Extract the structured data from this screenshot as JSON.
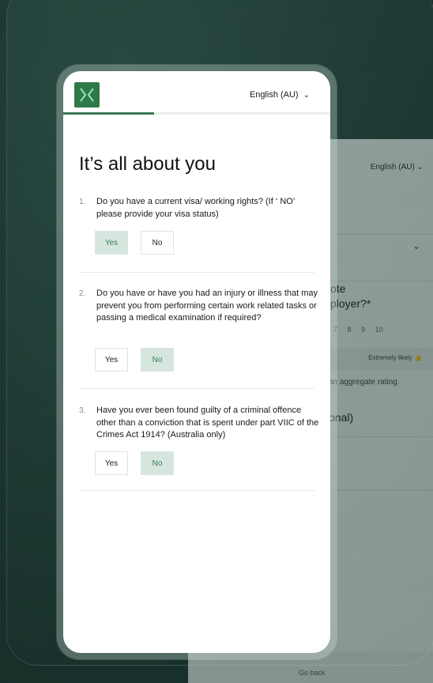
{
  "language_selector": "English (AU)",
  "progress_fraction": 0.34,
  "title": "It’s all about you",
  "questions": [
    {
      "num": "1.",
      "text": "Do you have a current visa/ working rights? (If ‘ NO’ please provide your visa status)",
      "yes": "Yes",
      "no": "No",
      "selected": "yes"
    },
    {
      "num": "2.",
      "text": "Do you have or have you had an injury or illness that may prevent you from performing certain work related tasks or passing a medical examination if required?",
      "yes": "Yes",
      "no": "No",
      "selected": "no"
    },
    {
      "num": "3.",
      "text": "Have you ever been found guilty of a criminal offence other than a conviction that is spent under part VIIC of the Crimes Act 1914? (Australia only)",
      "yes": "Yes",
      "no": "No",
      "selected": "no"
    }
  ],
  "back_card": {
    "language_selector": "English (AU)",
    "question_fragment_1": "ote",
    "question_fragment_2": "ployer?*",
    "scale": "7 8 9 10",
    "likely_label": "Extremely likely",
    "aggregate_text": "an aggregate rating.",
    "optional_fragment": "onal)",
    "go_back": "Go back"
  },
  "colors": {
    "brand": "#2f7a48",
    "selected_bg": "#d6e6df",
    "selected_text": "#3b7a57"
  },
  "icons": {
    "logo": "x-logo-icon",
    "language_chevron": "chevron-down-icon",
    "thumbs_up": "thumbs-up-icon"
  }
}
